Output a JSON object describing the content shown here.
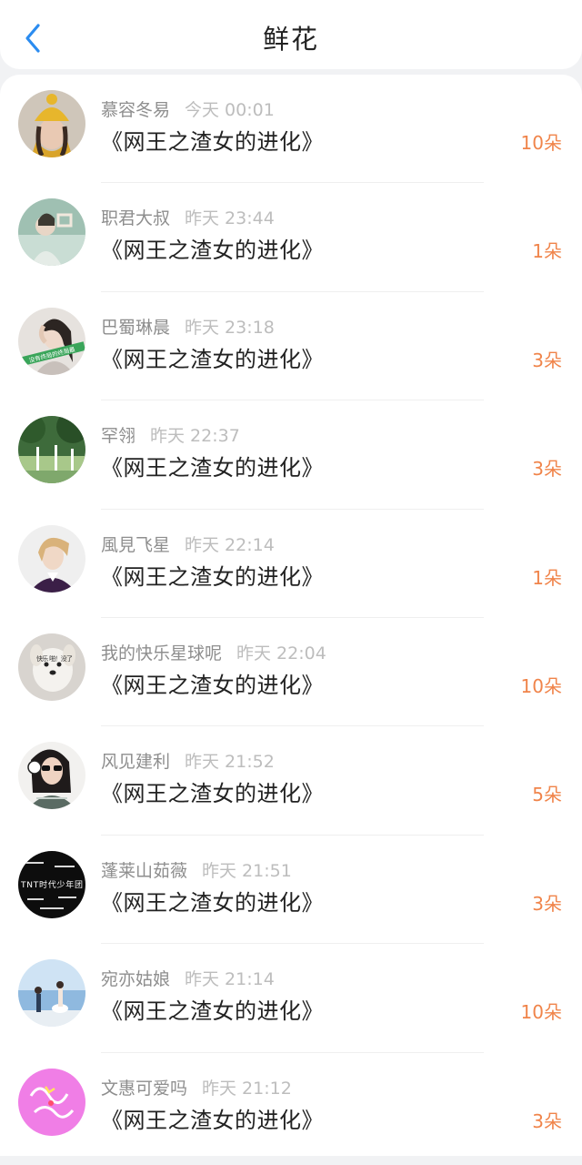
{
  "header": {
    "title": "鲜花",
    "back_icon": "chevron-left-icon",
    "accent": "#2b8cf0"
  },
  "count_color": "#f0844a",
  "items": [
    {
      "name": "慕容冬易",
      "time": "今天 00:01",
      "book": "《网王之渣女的进化》",
      "count": "10朵"
    },
    {
      "name": "职君大叔",
      "time": "昨天 23:44",
      "book": "《网王之渣女的进化》",
      "count": "1朵"
    },
    {
      "name": "巴蜀琳晨",
      "time": "昨天 23:18",
      "book": "《网王之渣女的进化》",
      "count": "3朵",
      "avatar_text": "没有终局的终局最"
    },
    {
      "name": "罕翎",
      "time": "昨天 22:37",
      "book": "《网王之渣女的进化》",
      "count": "3朵"
    },
    {
      "name": "風見飞星",
      "time": "昨天 22:14",
      "book": "《网王之渣女的进化》",
      "count": "1朵"
    },
    {
      "name": "我的快乐星球呢",
      "time": "昨天 22:04",
      "book": "《网王之渣女的进化》",
      "count": "10朵",
      "avatar_text": "快乐 啪！没了"
    },
    {
      "name": "风见建利",
      "time": "昨天 21:52",
      "book": "《网王之渣女的进化》",
      "count": "5朵"
    },
    {
      "name": "蓬莱山茹薇",
      "time": "昨天 21:51",
      "book": "《网王之渣女的进化》",
      "count": "3朵",
      "avatar_text": "TNT时代少年团"
    },
    {
      "name": "宛亦姑娘",
      "time": "昨天 21:14",
      "book": "《网王之渣女的进化》",
      "count": "10朵"
    },
    {
      "name": "文惠可爱吗",
      "time": "昨天 21:12",
      "book": "《网王之渣女的进化》",
      "count": "3朵"
    }
  ]
}
